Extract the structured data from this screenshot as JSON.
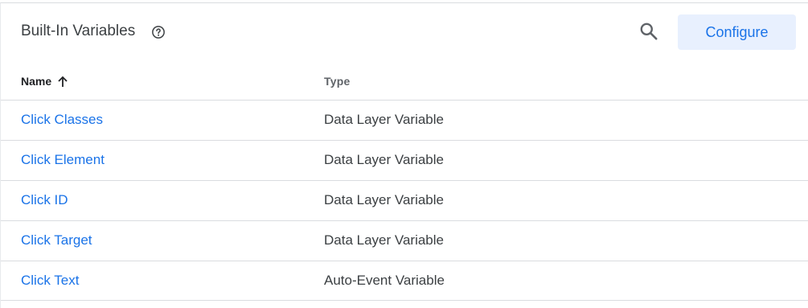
{
  "header": {
    "title": "Built-In Variables",
    "help_icon": "help-circle-icon",
    "search_icon": "search-icon",
    "configure_label": "Configure"
  },
  "table": {
    "columns": [
      {
        "label": "Name",
        "sort": "ascending",
        "sort_icon": "arrow-up-icon"
      },
      {
        "label": "Type"
      }
    ],
    "rows": [
      {
        "name": "Click Classes",
        "type": "Data Layer Variable"
      },
      {
        "name": "Click Element",
        "type": "Data Layer Variable"
      },
      {
        "name": "Click ID",
        "type": "Data Layer Variable"
      },
      {
        "name": "Click Target",
        "type": "Data Layer Variable"
      },
      {
        "name": "Click Text",
        "type": "Auto-Event Variable"
      }
    ]
  },
  "colors": {
    "accent": "#1a73e8",
    "button_bg": "#e8f0fe",
    "divider": "#dadce0",
    "text": "#3c4043"
  }
}
